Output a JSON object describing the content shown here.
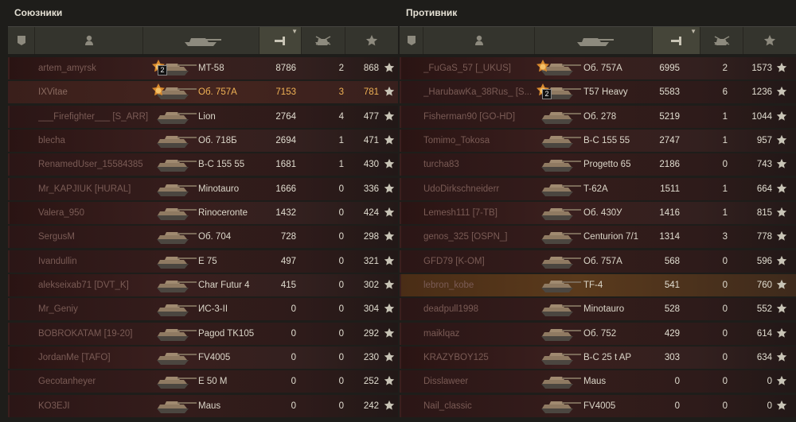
{
  "allies": {
    "title": "Союзники",
    "rows": [
      {
        "player": "artem_amyrsk",
        "vehicle": "MT-58",
        "damage": "8786",
        "kills": "2",
        "xp": "868",
        "medal": true,
        "badge": "2"
      },
      {
        "player": "IXVitae",
        "vehicle": "Об. 757А",
        "damage": "7153",
        "kills": "3",
        "xp": "781",
        "medal": true,
        "badge": "",
        "player_row": true
      },
      {
        "player": "___Firefighter___ [S_ARR]",
        "vehicle": "Lion",
        "damage": "2764",
        "kills": "4",
        "xp": "477"
      },
      {
        "player": "blecha",
        "vehicle": "Об. 718Б",
        "damage": "2694",
        "kills": "1",
        "xp": "471"
      },
      {
        "player": "RenamedUser_15584385",
        "vehicle": "B-C 155 55",
        "damage": "1681",
        "kills": "1",
        "xp": "430"
      },
      {
        "player": "Mr_KAPJIUK [HURAL]",
        "vehicle": "Minotauro",
        "damage": "1666",
        "kills": "0",
        "xp": "336"
      },
      {
        "player": "Valera_950",
        "vehicle": "Rinoceronte",
        "damage": "1432",
        "kills": "0",
        "xp": "424"
      },
      {
        "player": "SergusM",
        "vehicle": "Об. 704",
        "damage": "728",
        "kills": "0",
        "xp": "298"
      },
      {
        "player": "Ivandullin",
        "vehicle": "E 75",
        "damage": "497",
        "kills": "0",
        "xp": "321"
      },
      {
        "player": "alekseixab71 [DVT_K]",
        "vehicle": "Char Futur 4",
        "damage": "415",
        "kills": "0",
        "xp": "302"
      },
      {
        "player": "Mr_Geniy",
        "vehicle": "ИС-3-II",
        "damage": "0",
        "kills": "0",
        "xp": "304"
      },
      {
        "player": "BOBROKATAM [19-20]",
        "vehicle": "Pagod TK105",
        "damage": "0",
        "kills": "0",
        "xp": "292"
      },
      {
        "player": "JordanMe [TAFO]",
        "vehicle": "FV4005",
        "damage": "0",
        "kills": "0",
        "xp": "230"
      },
      {
        "player": "Gecotanheyer",
        "vehicle": "E 50 M",
        "damage": "0",
        "kills": "0",
        "xp": "252"
      },
      {
        "player": "KO3EJI",
        "vehicle": "Maus",
        "damage": "0",
        "kills": "0",
        "xp": "242"
      }
    ]
  },
  "enemies": {
    "title": "Противник",
    "rows": [
      {
        "player": "_FuGaS_57 [_UKUS]",
        "vehicle": "Об. 757А",
        "damage": "6995",
        "kills": "2",
        "xp": "1573",
        "medal": true,
        "badge": ""
      },
      {
        "player": "_HarubawKa_38Rus_ [S...",
        "vehicle": "T57 Heavy",
        "damage": "5583",
        "kills": "6",
        "xp": "1236",
        "medal": true,
        "badge": "2"
      },
      {
        "player": "Fisherman90 [GO-HD]",
        "vehicle": "Об. 278",
        "damage": "5219",
        "kills": "1",
        "xp": "1044"
      },
      {
        "player": "Tomimo_Tokosa",
        "vehicle": "B-C 155 55",
        "damage": "2747",
        "kills": "1",
        "xp": "957"
      },
      {
        "player": "turcha83",
        "vehicle": "Progetto 65",
        "damage": "2186",
        "kills": "0",
        "xp": "743"
      },
      {
        "player": "UdoDirkschneiderr",
        "vehicle": "T-62A",
        "damage": "1511",
        "kills": "1",
        "xp": "664"
      },
      {
        "player": "Lemesh111 [7-TB]",
        "vehicle": "Об. 430У",
        "damage": "1416",
        "kills": "1",
        "xp": "815"
      },
      {
        "player": "genos_325 [OSPN_]",
        "vehicle": "Centurion 7/1",
        "damage": "1314",
        "kills": "3",
        "xp": "778"
      },
      {
        "player": "GFD79 [K-OM]",
        "vehicle": "Об. 757А",
        "damage": "568",
        "kills": "0",
        "xp": "596"
      },
      {
        "player": "lebron_kobe",
        "vehicle": "TF-4",
        "damage": "541",
        "kills": "0",
        "xp": "760",
        "highlight": true
      },
      {
        "player": "deadpull1998",
        "vehicle": "Minotauro",
        "damage": "528",
        "kills": "0",
        "xp": "552"
      },
      {
        "player": "maiklqaz",
        "vehicle": "Об. 752",
        "damage": "429",
        "kills": "0",
        "xp": "614"
      },
      {
        "player": "KRAZYBOY125",
        "vehicle": "B-C 25 t AP",
        "damage": "303",
        "kills": "0",
        "xp": "634"
      },
      {
        "player": "Disslaweer",
        "vehicle": "Maus",
        "damage": "0",
        "kills": "0",
        "xp": "0"
      },
      {
        "player": "Nail_classic",
        "vehicle": "FV4005",
        "damage": "0",
        "kills": "0",
        "xp": "0"
      }
    ]
  },
  "header_icons": [
    "platoon-icon",
    "player-icon",
    "vehicle-icon",
    "damage-icon",
    "kills-icon",
    "xp-icon"
  ],
  "colors": {
    "gold": "#f0b255",
    "row_bg": "#341c1b",
    "header_bg": "#34342d"
  }
}
